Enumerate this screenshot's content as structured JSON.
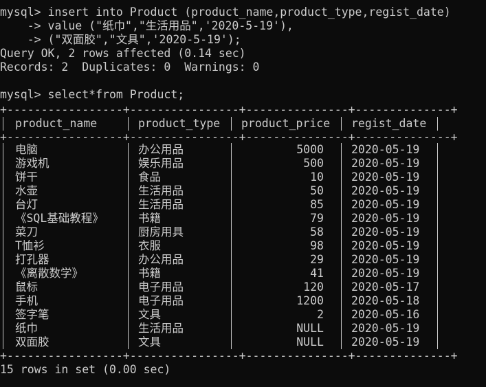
{
  "terminal": {
    "lines": [
      "mysql> insert into Product (product_name,product_type,regist_date)",
      "    -> value (\"纸巾\",\"生活用品\",'2020-5-19'),",
      "    -> (\"双面胶\",\"文具\",'2020-5-19');",
      "Query OK, 2 rows affected (0.14 sec)",
      "Records: 2  Duplicates: 0  Warnings: 0",
      "",
      "mysql> select*from Product;"
    ],
    "border": "+-----------------+----------------+---------------+--------------+",
    "columns": [
      "product_name",
      "product_type",
      "product_price",
      "regist_date"
    ],
    "rows": [
      [
        "电脑",
        "办公用品",
        "5000",
        "2020-05-19"
      ],
      [
        "游戏机",
        "娱乐用品",
        "500",
        "2020-05-19"
      ],
      [
        "饼干",
        "食品",
        "10",
        "2020-05-19"
      ],
      [
        "水壶",
        "生活用品",
        "50",
        "2020-05-19"
      ],
      [
        "台灯",
        "生活用品",
        "85",
        "2020-05-19"
      ],
      [
        "《SQL基础教程》",
        "书籍",
        "79",
        "2020-05-19"
      ],
      [
        "菜刀",
        "厨房用具",
        "58",
        "2020-05-19"
      ],
      [
        "T恤衫",
        "衣服",
        "98",
        "2020-05-19"
      ],
      [
        "打孔器",
        "办公用品",
        "29",
        "2020-05-19"
      ],
      [
        "《离散数学》",
        "书籍",
        "41",
        "2020-05-19"
      ],
      [
        "鼠标",
        "电子用品",
        "120",
        "2020-05-17"
      ],
      [
        "手机",
        "电子用品",
        "1200",
        "2020-05-18"
      ],
      [
        "签字笔",
        "文具",
        "2",
        "2020-05-16"
      ],
      [
        "纸巾",
        "生活用品",
        "NULL",
        "2020-05-19"
      ],
      [
        "双面胶",
        "文具",
        "NULL",
        "2020-05-19"
      ]
    ],
    "footer": "15 rows in set (0.00 sec)"
  },
  "colors": {
    "background": "#0c0c0c",
    "text": "#cccccc"
  }
}
